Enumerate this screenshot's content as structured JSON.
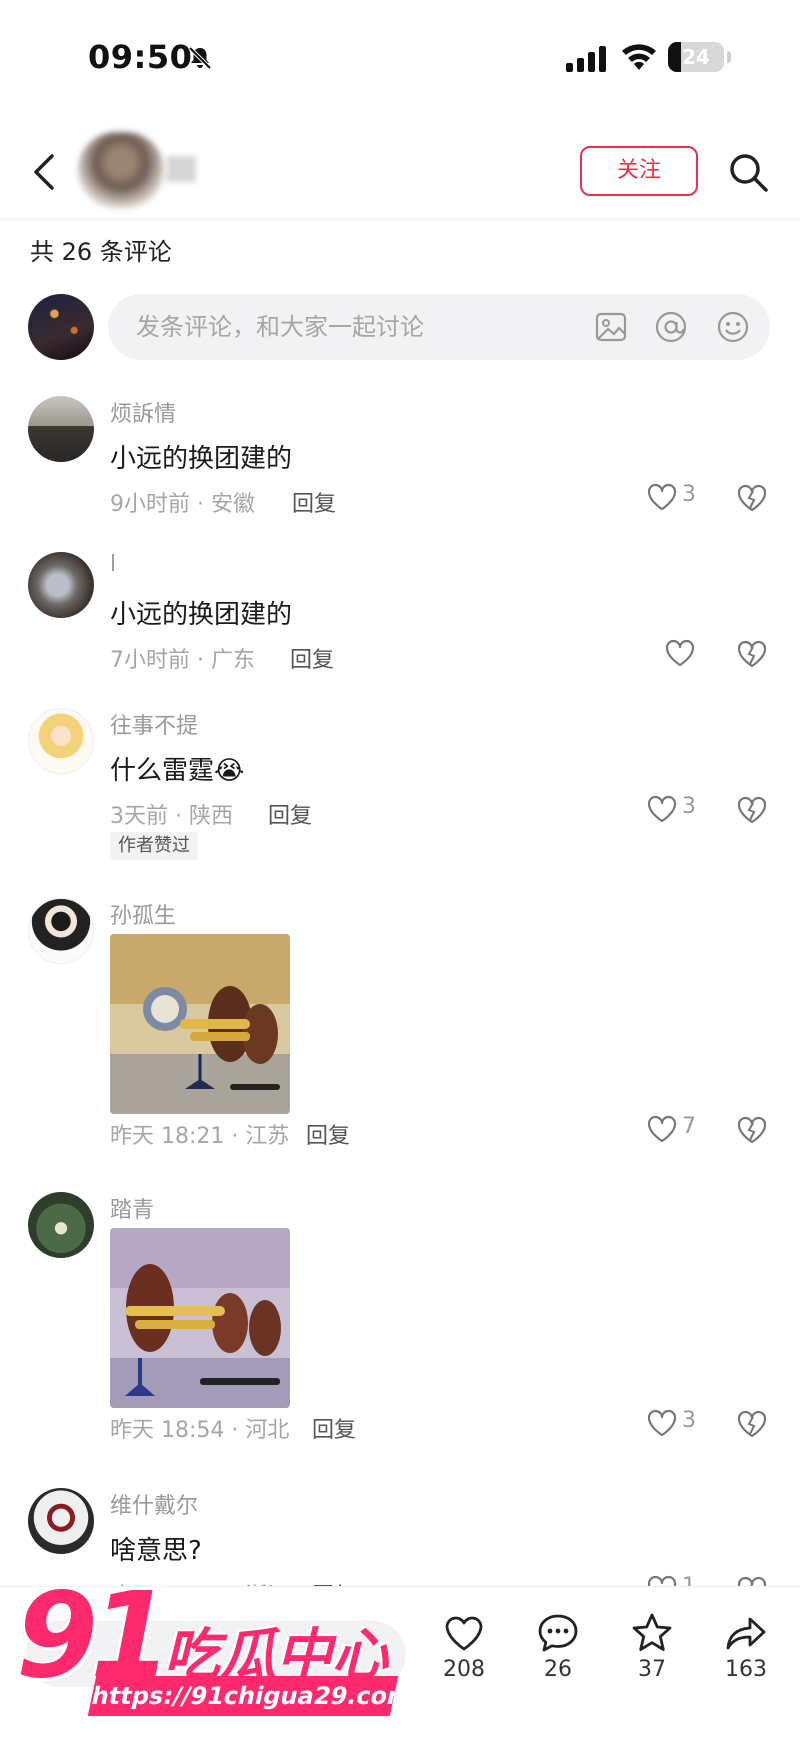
{
  "status": {
    "time": "09:50",
    "battery": "24",
    "battery_level": 0.24
  },
  "nav": {
    "follow_label": "关注",
    "user_name": ""
  },
  "comments_header": {
    "title": "共 26 条评论"
  },
  "comment_input": {
    "placeholder": "发条评论，和大家一起讨论"
  },
  "comments": [
    {
      "user": "烦訴情",
      "text": "小远的换团建的",
      "meta": "9小时前 · 安徽",
      "reply": "回复",
      "likes": "3"
    },
    {
      "user": "l",
      "text": "小远的换团建的",
      "meta": "7小时前 · 广东",
      "reply": "回复",
      "likes": ""
    },
    {
      "user": "往事不提",
      "text": "什么雷霆😭",
      "meta": "3天前 · 陕西",
      "reply": "回复",
      "likes": "3",
      "badge": "作者赞过"
    },
    {
      "user": "孙孤生",
      "meta": "昨天 18:21 · 江苏",
      "reply": "回复",
      "likes": "7"
    },
    {
      "user": "踏青",
      "meta": "昨天 18:54 · 河北",
      "reply": "回复",
      "likes": "3"
    },
    {
      "user": "维什戴尔",
      "text": "啥意思?",
      "meta": "昨天 20:38 · 浙江",
      "reply": "回复",
      "likes": "1"
    }
  ],
  "bottom_bar": {
    "likes": "208",
    "comments": "26",
    "favorites": "37",
    "shares": "163"
  },
  "watermark": {
    "number": "91",
    "text": "吃瓜中心",
    "url": "https://91chigua29.com"
  },
  "colors": {
    "accent": "#e8334a",
    "watermark": "#ff2a6d"
  }
}
